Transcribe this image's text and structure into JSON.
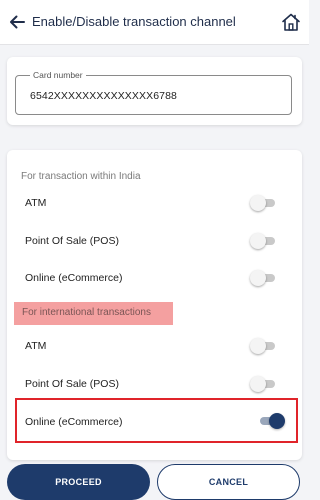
{
  "header": {
    "title": "Enable/Disable transaction channel"
  },
  "card_number": {
    "label": "Card number",
    "value": "6542XXXXXXXXXXXXXX6788"
  },
  "domestic": {
    "title": "For transaction within India",
    "rows": [
      {
        "label": "ATM",
        "enabled": false
      },
      {
        "label": "Point Of Sale (POS)",
        "enabled": false
      },
      {
        "label": "Online (eCommerce)",
        "enabled": false
      }
    ]
  },
  "international": {
    "title": "For international transactions",
    "rows": [
      {
        "label": "ATM",
        "enabled": false
      },
      {
        "label": "Point Of Sale (POS)",
        "enabled": false
      },
      {
        "label": "Online (eCommerce)",
        "enabled": true
      }
    ]
  },
  "buttons": {
    "proceed": "PROCEED",
    "cancel": "CANCEL"
  },
  "icons": {
    "back": "arrow-left-icon",
    "home": "home-icon"
  },
  "colors": {
    "primary": "#1e3b6b",
    "highlight": "#f4a0a0",
    "annotation_box": "#e0242a"
  }
}
